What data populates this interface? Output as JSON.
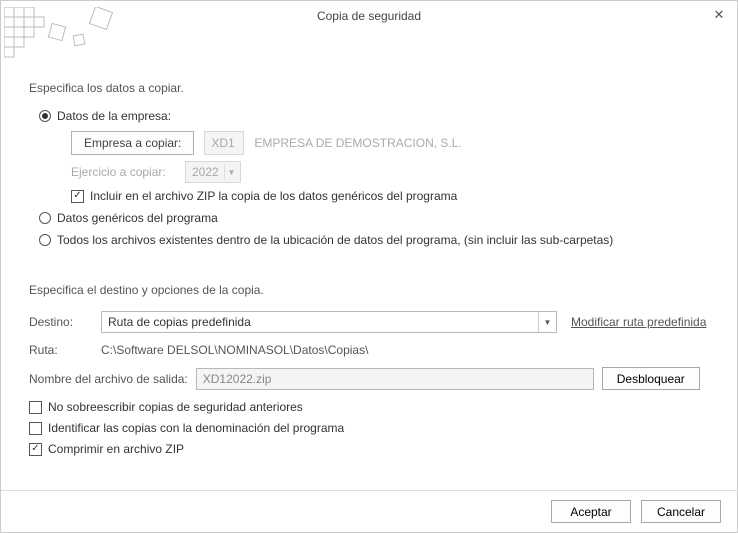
{
  "window": {
    "title": "Copia de seguridad"
  },
  "section1": {
    "heading": "Especifica los datos a copiar.",
    "opt_company": "Datos de la empresa:",
    "company_button": "Empresa a copiar:",
    "company_code": "XD1",
    "company_name": "EMPRESA DE DEMOSTRACION, S.L.",
    "year_label": "Ejercicio a copiar:",
    "year_value": "2022",
    "include_generic": "Incluir en el archivo ZIP la copia de los datos genéricos del programa",
    "opt_generic": "Datos genéricos del programa",
    "opt_allfiles": "Todos los archivos existentes dentro de la ubicación de datos del programa, (sin incluir las sub-carpetas)"
  },
  "section2": {
    "heading": "Especifica el destino y opciones de la copia.",
    "dest_label": "Destino:",
    "dest_value": "Ruta de copias predefinida",
    "dest_link": "Modificar ruta predefinida",
    "path_label": "Ruta:",
    "path_value": "C:\\Software DELSOL\\NOMINASOL\\Datos\\Copias\\",
    "outfile_label": "Nombre del archivo de salida:",
    "outfile_value": "XD12022.zip",
    "unlock_btn": "Desbloquear",
    "chk_nooverwrite": "No sobreescribir copias de seguridad anteriores",
    "chk_identify": "Identificar las copias con la denominación del programa",
    "chk_zip": "Comprimir en archivo ZIP"
  },
  "footer": {
    "ok": "Aceptar",
    "cancel": "Cancelar"
  }
}
